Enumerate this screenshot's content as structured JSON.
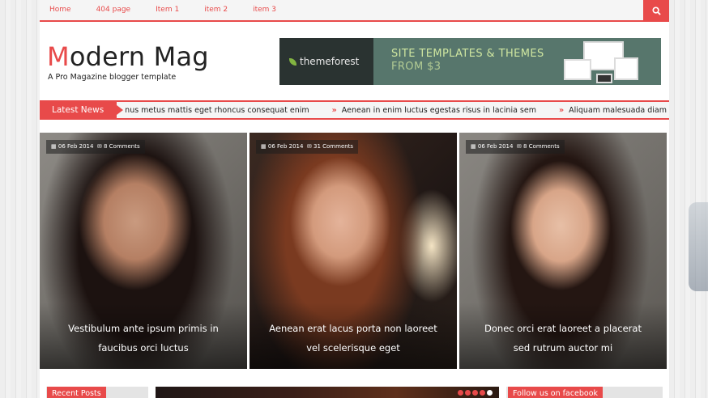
{
  "nav": {
    "items": [
      "Home",
      "404 page",
      "Item 1",
      "item 2",
      "item 3"
    ],
    "search_icon": "search-icon"
  },
  "header": {
    "title_first": "M",
    "title_rest": "odern Mag",
    "tagline": "A Pro Magazine blogger template"
  },
  "ad": {
    "brand": "themeforest",
    "line1": "SITE TEMPLATES & THEMES",
    "line2": "FROM $3"
  },
  "ticker": {
    "label": "Latest News",
    "items": [
      "nus metus mattis eget rhoncus consequat enim",
      "Aenean in enim luctus egestas risus in lacinia sem",
      "Aliquam malesuada diam eget turpis varius"
    ]
  },
  "cards": [
    {
      "date": "06 Feb 2014",
      "comments": "8 Comments",
      "caption": "Vestibulum ante ipsum primis in faucibus orci luctus"
    },
    {
      "date": "06 Feb 2014",
      "comments": "31 Comments",
      "caption": "Aenean erat lacus porta non laoreet vel scelerisque eget"
    },
    {
      "date": "06 Feb 2014",
      "comments": "8 Comments",
      "caption": "Donec orci erat laoreet a placerat sed rutrum auctor mi"
    }
  ],
  "bottom": {
    "recent_posts": "Recent Posts",
    "follow": "Follow us on facebook"
  },
  "colors": {
    "accent": "#e84a4a",
    "ad_bg": "#57766c",
    "ad_text": "#cfe6a0"
  }
}
